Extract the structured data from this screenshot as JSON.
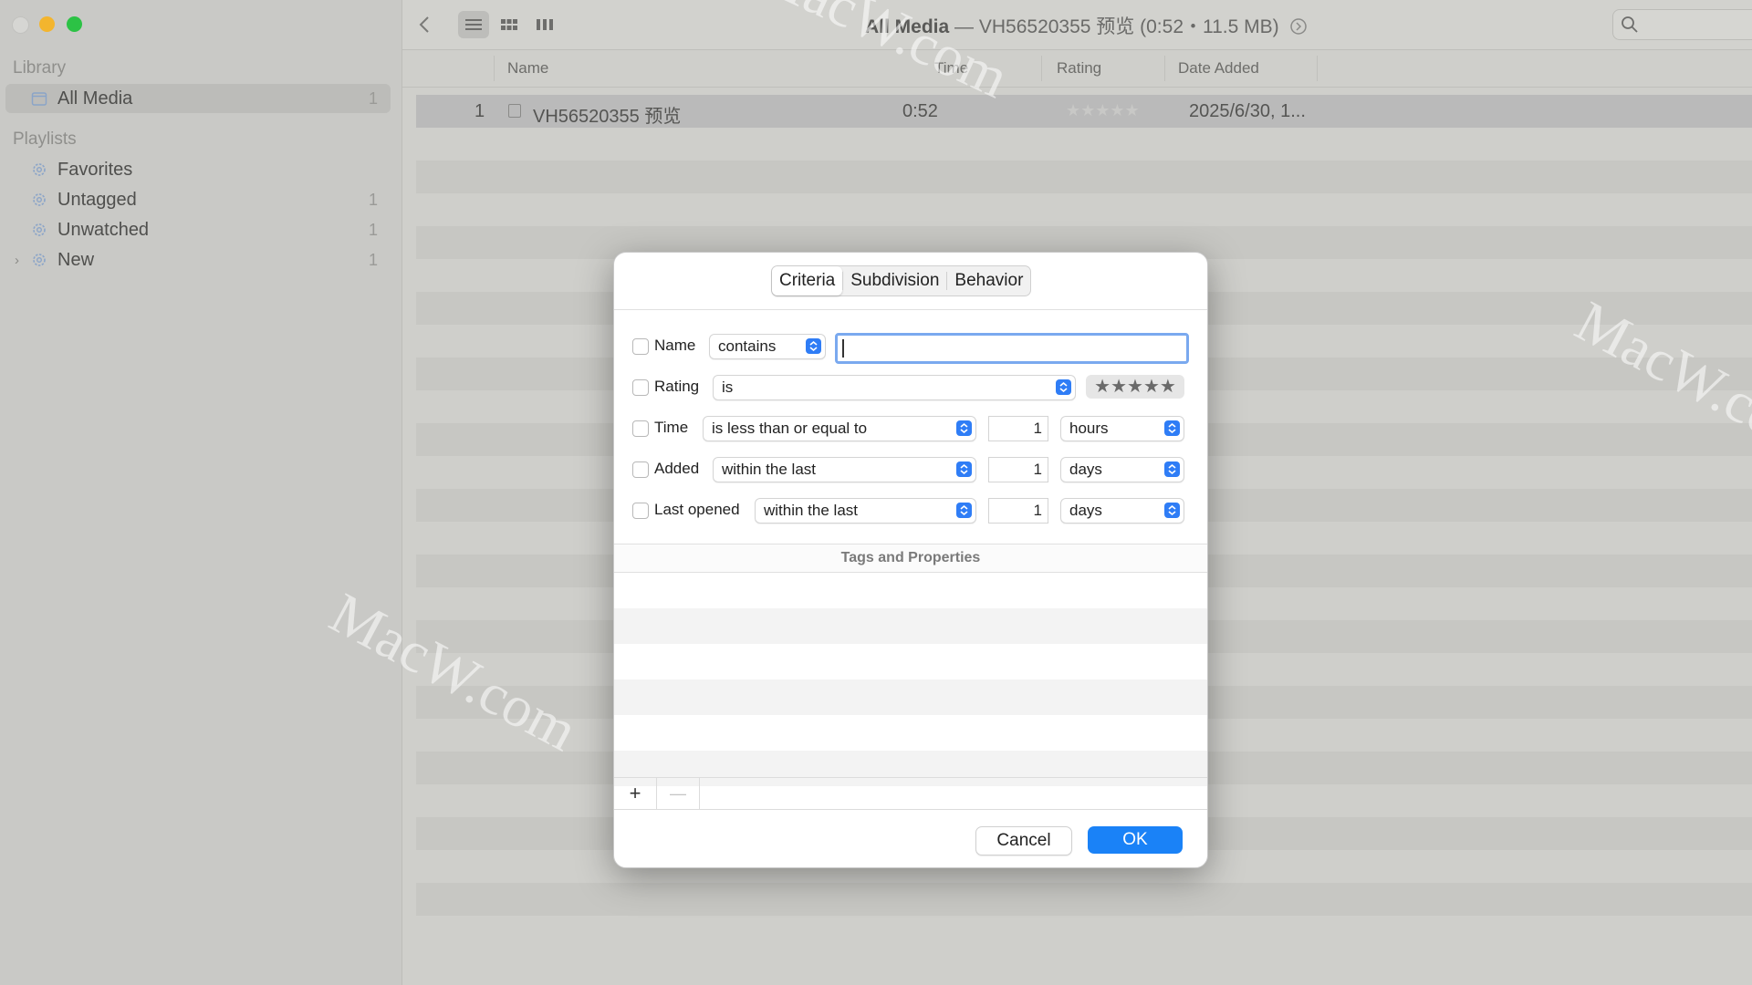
{
  "window": {
    "title_bold": "All Media",
    "title_rest": " — VH56520355 预览 (0:52・11.5 MB)"
  },
  "sidebar": {
    "library_title": "Library",
    "library_items": [
      {
        "label": "All Media",
        "count": "1"
      }
    ],
    "playlists_title": "Playlists",
    "playlist_items": [
      {
        "label": "Favorites",
        "count": ""
      },
      {
        "label": "Untagged",
        "count": "1"
      },
      {
        "label": "Unwatched",
        "count": "1"
      },
      {
        "label": "New",
        "count": "1"
      }
    ]
  },
  "table": {
    "headers": {
      "name": "Name",
      "time": "Time",
      "rating": "Rating",
      "date_added": "Date Added"
    },
    "rows": [
      {
        "index": "1",
        "name": "VH56520355 预览",
        "time": "0:52",
        "rating": "★★★★★",
        "date_added": "2025/6/30, 1..."
      }
    ]
  },
  "watermark": "MacW.com",
  "dialog": {
    "tabs": [
      "Criteria",
      "Subdivision",
      "Behavior"
    ],
    "active_tab": "Criteria",
    "criteria": {
      "name": {
        "label": "Name",
        "op": "contains",
        "value": ""
      },
      "rating": {
        "label": "Rating",
        "op": "is",
        "stars": "★★★★★"
      },
      "time": {
        "label": "Time",
        "op": "is less than or equal to",
        "amount": "1",
        "unit": "hours"
      },
      "added": {
        "label": "Added",
        "op": "within the last",
        "amount": "1",
        "unit": "days"
      },
      "last_opened": {
        "label": "Last opened",
        "op": "within the last",
        "amount": "1",
        "unit": "days"
      }
    },
    "tags_header": "Tags and Properties",
    "add_label": "+",
    "remove_label": "—",
    "cancel_label": "Cancel",
    "ok_label": "OK"
  },
  "colors": {
    "accent": "#1a82f7",
    "stepper": "#2f7df6"
  }
}
